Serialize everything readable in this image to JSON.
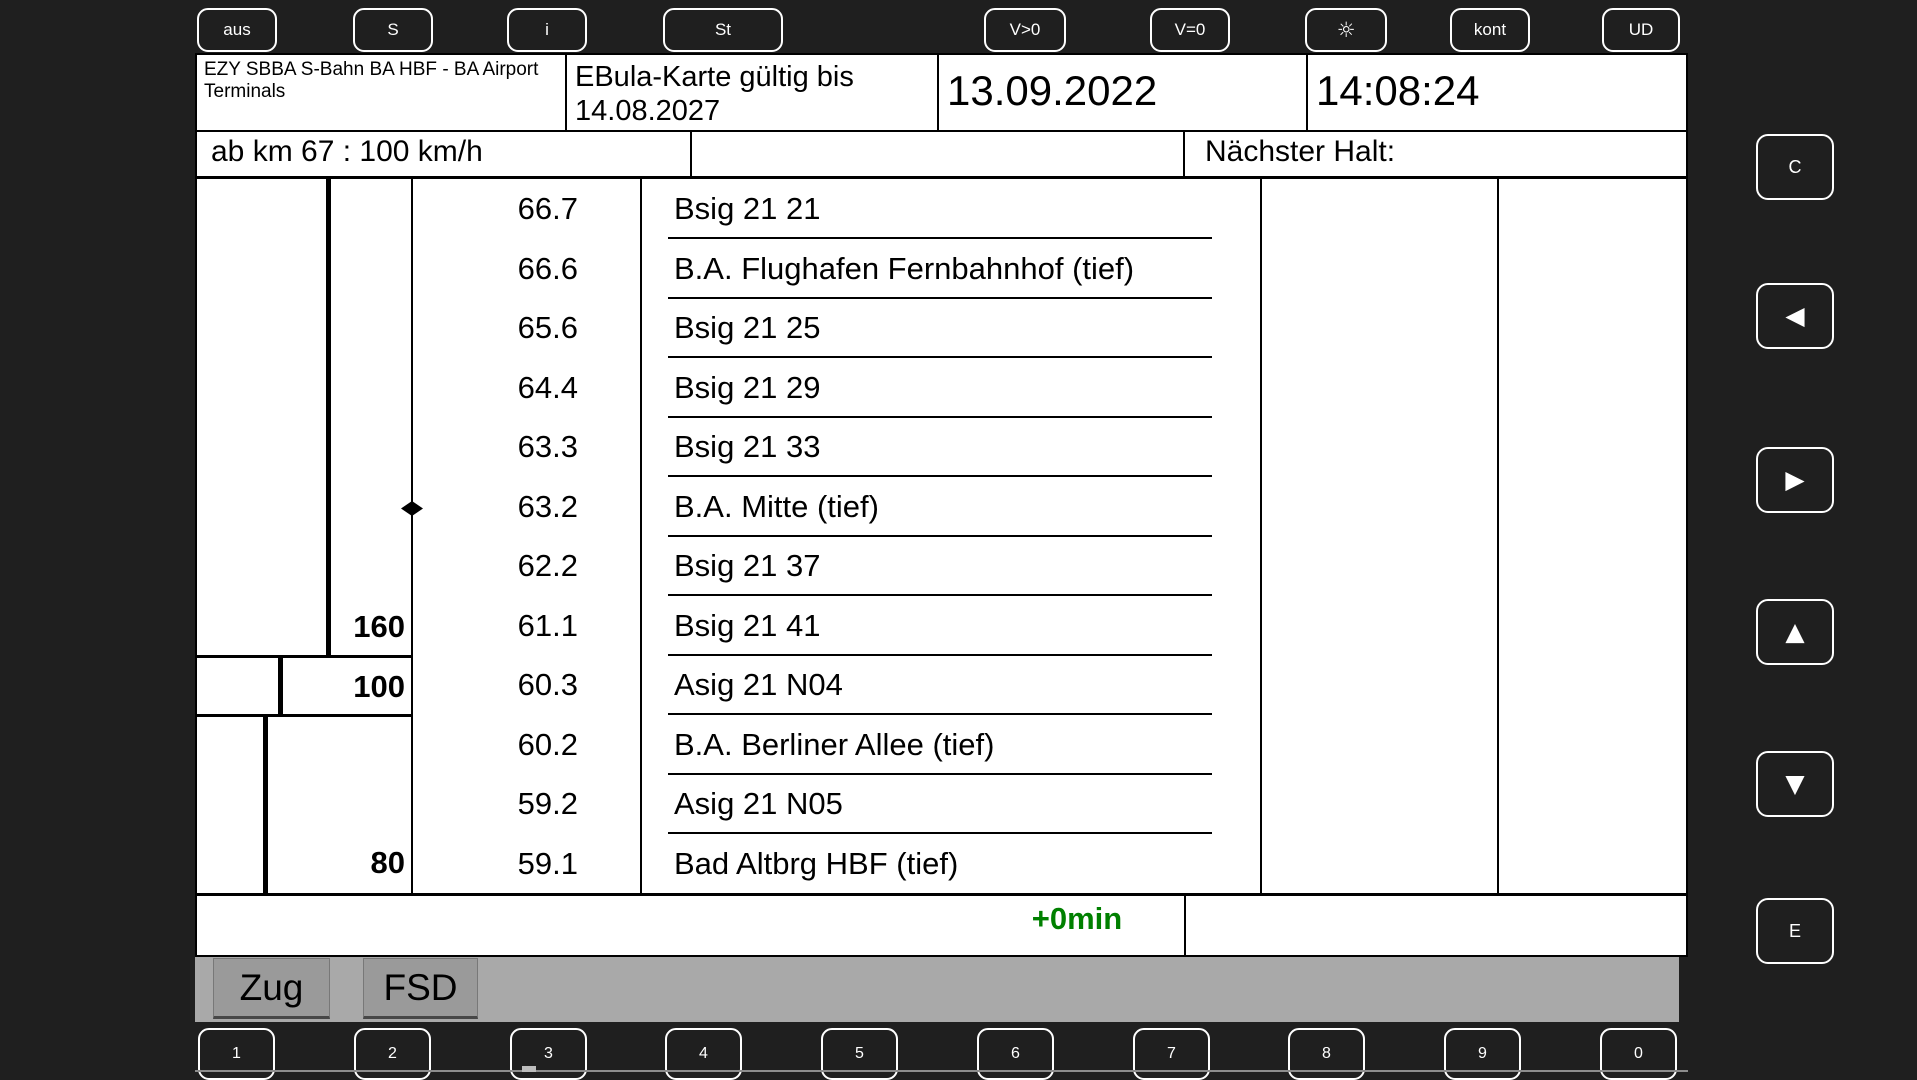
{
  "colors": {
    "background": "#1f1f1f",
    "panel": "#ffffff",
    "delay_green": "#008000",
    "gray_bar": "#a9a9a9",
    "tab_gray": "#9a9a9a"
  },
  "top_buttons": [
    {
      "label": "aus"
    },
    {
      "label": "S"
    },
    {
      "label": "i"
    },
    {
      "label": "St"
    },
    {
      "label": "V>0"
    },
    {
      "label": "V=0"
    },
    {
      "label": "☼"
    },
    {
      "label": "kont"
    },
    {
      "label": "UD"
    }
  ],
  "header": {
    "route": "EZY SBBA S-Bahn BA HBF - BA Airport Terminals",
    "validity_line1": "EBula-Karte gültig bis",
    "validity_line2": "14.08.2027",
    "date": "13.09.2022",
    "time": "14:08:24"
  },
  "subheader": {
    "speed_restriction": "ab km 67 : 100 km/h",
    "next_stop_label": "Nächster Halt:"
  },
  "schedule": {
    "rows": [
      {
        "km": "66.7",
        "name": "Bsig 21 21"
      },
      {
        "km": "66.6",
        "name": "B.A. Flughafen Fernbahnhof (tief)"
      },
      {
        "km": "65.6",
        "name": "Bsig 21 25"
      },
      {
        "km": "64.4",
        "name": "Bsig 21 29"
      },
      {
        "km": "63.3",
        "name": "Bsig 21 33"
      },
      {
        "km": "63.2",
        "name": "B.A. Mitte (tief)"
      },
      {
        "km": "62.2",
        "name": "Bsig 21 37"
      },
      {
        "km": "61.1",
        "name": "Bsig 21 41"
      },
      {
        "km": "60.3",
        "name": "Asig 21 N04"
      },
      {
        "km": "60.2",
        "name": "B.A. Berliner Allee (tief)"
      },
      {
        "km": "59.2",
        "name": "Asig 21 N05"
      },
      {
        "km": "59.1",
        "name": "Bad Altbrg HBF (tief)"
      }
    ],
    "speed_labels": [
      {
        "value": "160"
      },
      {
        "value": "100"
      },
      {
        "value": "80"
      }
    ],
    "marker_at_km": "63.2"
  },
  "footer": {
    "delay": "+0min"
  },
  "tabs": [
    {
      "label": "Zug"
    },
    {
      "label": "FSD"
    }
  ],
  "bottom_buttons": [
    {
      "label": "1"
    },
    {
      "label": "2"
    },
    {
      "label": "3"
    },
    {
      "label": "4"
    },
    {
      "label": "5"
    },
    {
      "label": "6"
    },
    {
      "label": "7"
    },
    {
      "label": "8"
    },
    {
      "label": "9"
    },
    {
      "label": "0"
    }
  ],
  "side_buttons": [
    {
      "label": "C"
    },
    {
      "label": "◀"
    },
    {
      "label": "▶"
    },
    {
      "label": "▲"
    },
    {
      "label": "▼"
    },
    {
      "label": "E"
    }
  ]
}
